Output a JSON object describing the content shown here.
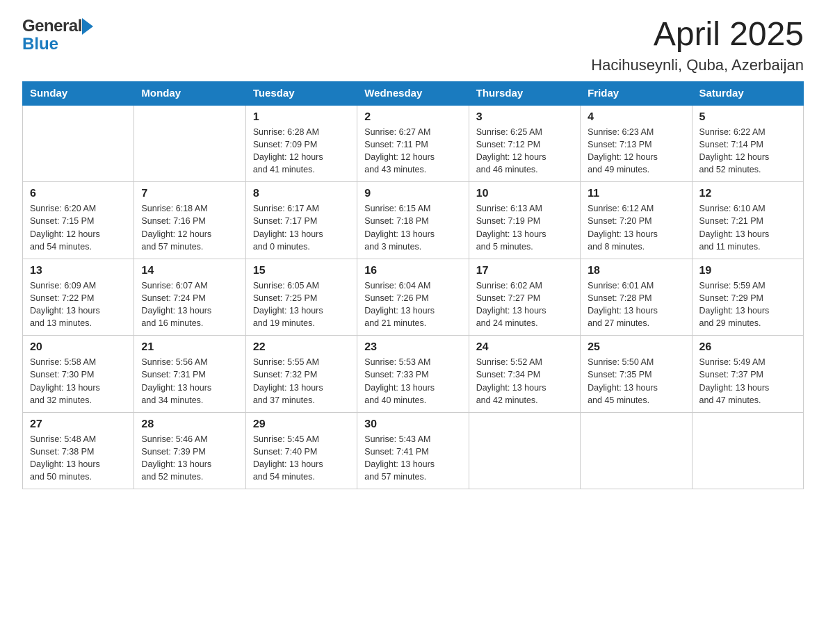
{
  "header": {
    "logo_general": "General",
    "logo_blue": "Blue",
    "title": "April 2025",
    "subtitle": "Hacihuseynli, Quba, Azerbaijan"
  },
  "days_of_week": [
    "Sunday",
    "Monday",
    "Tuesday",
    "Wednesday",
    "Thursday",
    "Friday",
    "Saturday"
  ],
  "weeks": [
    [
      {
        "day": "",
        "info": ""
      },
      {
        "day": "",
        "info": ""
      },
      {
        "day": "1",
        "info": "Sunrise: 6:28 AM\nSunset: 7:09 PM\nDaylight: 12 hours\nand 41 minutes."
      },
      {
        "day": "2",
        "info": "Sunrise: 6:27 AM\nSunset: 7:11 PM\nDaylight: 12 hours\nand 43 minutes."
      },
      {
        "day": "3",
        "info": "Sunrise: 6:25 AM\nSunset: 7:12 PM\nDaylight: 12 hours\nand 46 minutes."
      },
      {
        "day": "4",
        "info": "Sunrise: 6:23 AM\nSunset: 7:13 PM\nDaylight: 12 hours\nand 49 minutes."
      },
      {
        "day": "5",
        "info": "Sunrise: 6:22 AM\nSunset: 7:14 PM\nDaylight: 12 hours\nand 52 minutes."
      }
    ],
    [
      {
        "day": "6",
        "info": "Sunrise: 6:20 AM\nSunset: 7:15 PM\nDaylight: 12 hours\nand 54 minutes."
      },
      {
        "day": "7",
        "info": "Sunrise: 6:18 AM\nSunset: 7:16 PM\nDaylight: 12 hours\nand 57 minutes."
      },
      {
        "day": "8",
        "info": "Sunrise: 6:17 AM\nSunset: 7:17 PM\nDaylight: 13 hours\nand 0 minutes."
      },
      {
        "day": "9",
        "info": "Sunrise: 6:15 AM\nSunset: 7:18 PM\nDaylight: 13 hours\nand 3 minutes."
      },
      {
        "day": "10",
        "info": "Sunrise: 6:13 AM\nSunset: 7:19 PM\nDaylight: 13 hours\nand 5 minutes."
      },
      {
        "day": "11",
        "info": "Sunrise: 6:12 AM\nSunset: 7:20 PM\nDaylight: 13 hours\nand 8 minutes."
      },
      {
        "day": "12",
        "info": "Sunrise: 6:10 AM\nSunset: 7:21 PM\nDaylight: 13 hours\nand 11 minutes."
      }
    ],
    [
      {
        "day": "13",
        "info": "Sunrise: 6:09 AM\nSunset: 7:22 PM\nDaylight: 13 hours\nand 13 minutes."
      },
      {
        "day": "14",
        "info": "Sunrise: 6:07 AM\nSunset: 7:24 PM\nDaylight: 13 hours\nand 16 minutes."
      },
      {
        "day": "15",
        "info": "Sunrise: 6:05 AM\nSunset: 7:25 PM\nDaylight: 13 hours\nand 19 minutes."
      },
      {
        "day": "16",
        "info": "Sunrise: 6:04 AM\nSunset: 7:26 PM\nDaylight: 13 hours\nand 21 minutes."
      },
      {
        "day": "17",
        "info": "Sunrise: 6:02 AM\nSunset: 7:27 PM\nDaylight: 13 hours\nand 24 minutes."
      },
      {
        "day": "18",
        "info": "Sunrise: 6:01 AM\nSunset: 7:28 PM\nDaylight: 13 hours\nand 27 minutes."
      },
      {
        "day": "19",
        "info": "Sunrise: 5:59 AM\nSunset: 7:29 PM\nDaylight: 13 hours\nand 29 minutes."
      }
    ],
    [
      {
        "day": "20",
        "info": "Sunrise: 5:58 AM\nSunset: 7:30 PM\nDaylight: 13 hours\nand 32 minutes."
      },
      {
        "day": "21",
        "info": "Sunrise: 5:56 AM\nSunset: 7:31 PM\nDaylight: 13 hours\nand 34 minutes."
      },
      {
        "day": "22",
        "info": "Sunrise: 5:55 AM\nSunset: 7:32 PM\nDaylight: 13 hours\nand 37 minutes."
      },
      {
        "day": "23",
        "info": "Sunrise: 5:53 AM\nSunset: 7:33 PM\nDaylight: 13 hours\nand 40 minutes."
      },
      {
        "day": "24",
        "info": "Sunrise: 5:52 AM\nSunset: 7:34 PM\nDaylight: 13 hours\nand 42 minutes."
      },
      {
        "day": "25",
        "info": "Sunrise: 5:50 AM\nSunset: 7:35 PM\nDaylight: 13 hours\nand 45 minutes."
      },
      {
        "day": "26",
        "info": "Sunrise: 5:49 AM\nSunset: 7:37 PM\nDaylight: 13 hours\nand 47 minutes."
      }
    ],
    [
      {
        "day": "27",
        "info": "Sunrise: 5:48 AM\nSunset: 7:38 PM\nDaylight: 13 hours\nand 50 minutes."
      },
      {
        "day": "28",
        "info": "Sunrise: 5:46 AM\nSunset: 7:39 PM\nDaylight: 13 hours\nand 52 minutes."
      },
      {
        "day": "29",
        "info": "Sunrise: 5:45 AM\nSunset: 7:40 PM\nDaylight: 13 hours\nand 54 minutes."
      },
      {
        "day": "30",
        "info": "Sunrise: 5:43 AM\nSunset: 7:41 PM\nDaylight: 13 hours\nand 57 minutes."
      },
      {
        "day": "",
        "info": ""
      },
      {
        "day": "",
        "info": ""
      },
      {
        "day": "",
        "info": ""
      }
    ]
  ],
  "colors": {
    "header_bg": "#1a7bbf",
    "header_text": "#ffffff",
    "border": "#aaa",
    "day_number": "#222"
  }
}
